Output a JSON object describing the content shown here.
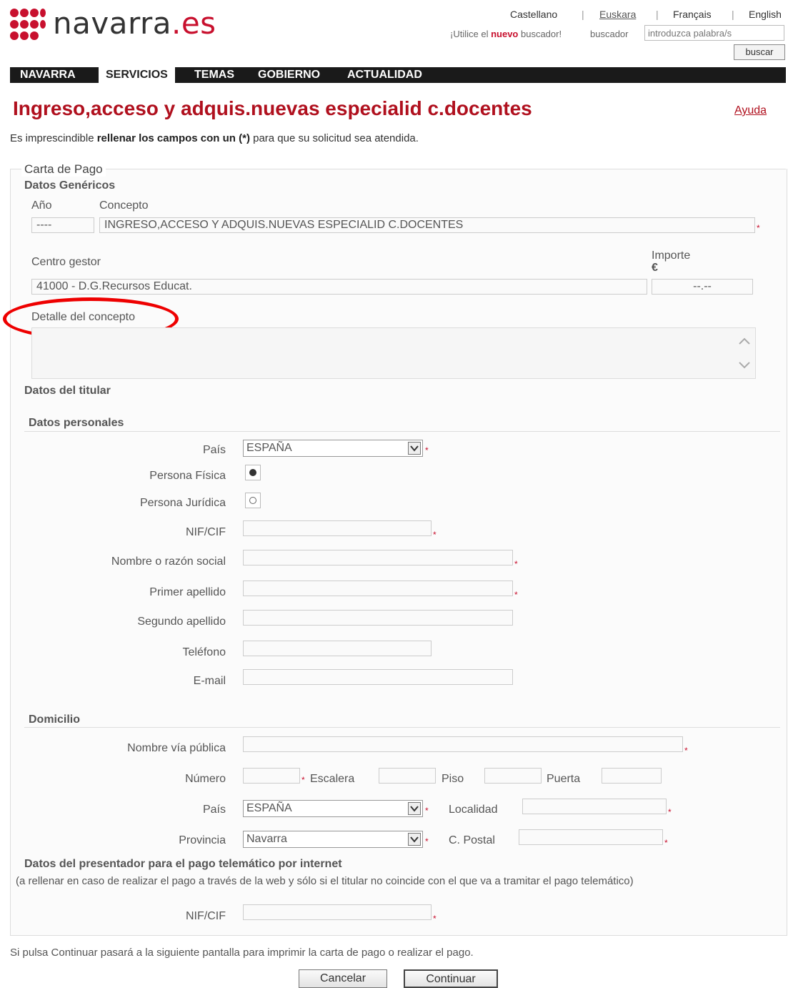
{
  "header": {
    "logo_text_main": "navarra",
    "logo_text_suffix": ".es",
    "languages": [
      "Castellano",
      "Euskara",
      "Français",
      "English"
    ],
    "language_separator": "|",
    "search_hint_pre": "¡Utilice el ",
    "search_hint_bold": "nuevo",
    "search_hint_post": " buscador!",
    "search_label": "buscador",
    "search_placeholder": "introduzca palabra/s",
    "search_button": "buscar"
  },
  "nav": {
    "items": [
      "NAVARRA",
      "SERVICIOS",
      "TEMAS",
      "GOBIERNO",
      "ACTUALIDAD"
    ],
    "active": "SERVICIOS"
  },
  "page": {
    "title": "Ingreso,acceso y adquis.nuevas especialid c.docentes",
    "help_link": "Ayuda",
    "intro_pre": "Es imprescindible ",
    "intro_bold": "rellenar los campos con un (*)",
    "intro_post": " para que su solicitud sea atendida."
  },
  "form": {
    "legend": "Carta de Pago",
    "generic_section": "Datos Genéricos",
    "year_label": "Año",
    "year_value": "----",
    "concept_label": "Concepto",
    "concept_value": "INGRESO,ACCESO Y ADQUIS.NUEVAS ESPECIALID C.DOCENTES",
    "center_label": "Centro gestor",
    "center_value": "41000 - D.G.Recursos Educat.",
    "amount_label": "Importe",
    "amount_currency": "€",
    "amount_value": "--.--",
    "detail_label": "Detalle del concepto",
    "holder_section": "Datos del titular",
    "personal_section": "Datos personales",
    "country_label": "País",
    "country_value": "ESPAÑA",
    "natural_person_label": "Persona Física",
    "legal_person_label": "Persona Jurídica",
    "nif_label": "NIF/CIF",
    "name_label": "Nombre o razón social",
    "surname1_label": "Primer apellido",
    "surname2_label": "Segundo apellido",
    "phone_label": "Teléfono",
    "email_label": "E-mail",
    "address_section": "Domicilio",
    "street_label": "Nombre vía pública",
    "number_label": "Número",
    "staircase_label": "Escalera",
    "floor_label": "Piso",
    "door_label": "Puerta",
    "addr_country_label": "País",
    "addr_country_value": "ESPAÑA",
    "locality_label": "Localidad",
    "province_label": "Provincia",
    "province_value": "Navarra",
    "postal_label": "C. Postal",
    "presenter_section": "Datos del presentador para el pago telemático por internet",
    "presenter_note": "(a rellenar en caso de realizar el pago a través de la web y sólo si el titular no coincide con el que va a tramitar el pago telemático)",
    "presenter_nif_label": "NIF/CIF",
    "required_mark": "*"
  },
  "footer": {
    "note": "Si pulsa Continuar pasará a la siguiente pantalla para imprimir la carta de pago o realizar el pago.",
    "cancel_button": "Cancelar",
    "continue_button": "Continuar"
  },
  "colors": {
    "brand": "#c8102e",
    "title": "#b0101e",
    "nav_bg": "#1a1a1a",
    "highlight": "#e00000"
  }
}
